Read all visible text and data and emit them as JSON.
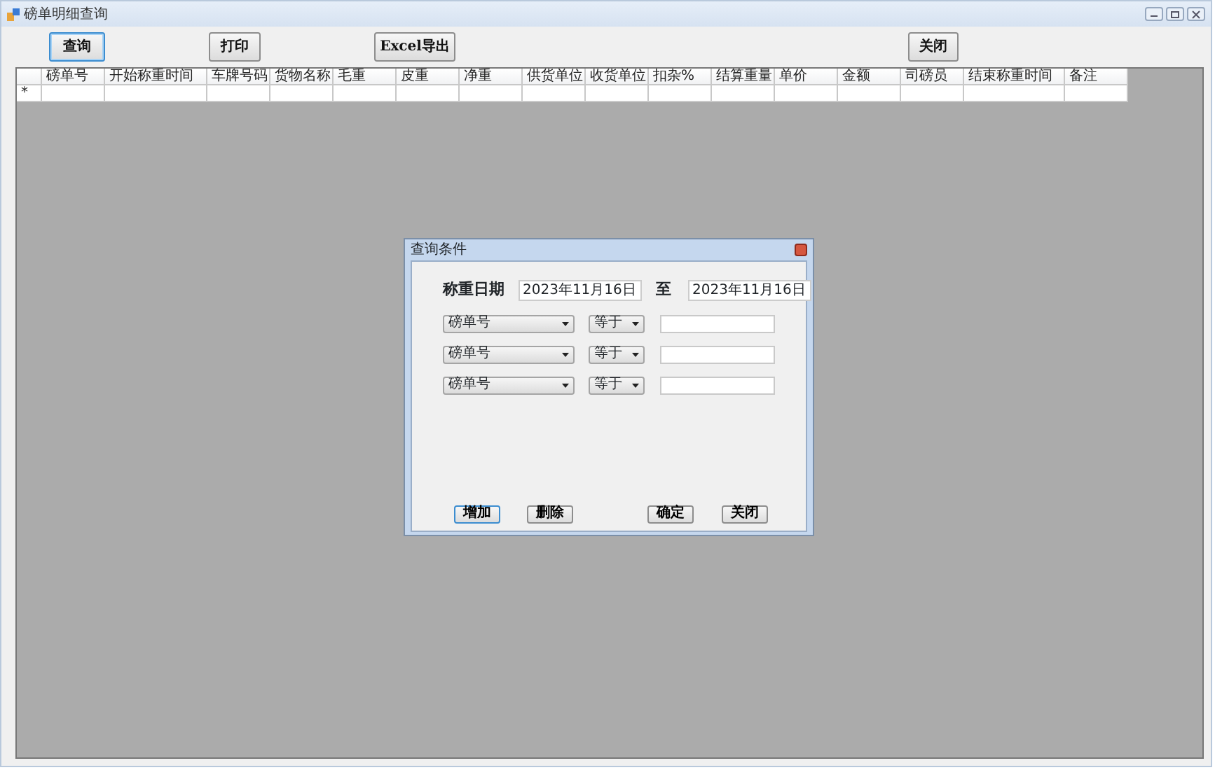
{
  "window": {
    "title": "磅单明细查询"
  },
  "toolbar": [
    {
      "label": "查询",
      "focused": true
    },
    {
      "label": "打印",
      "focused": false
    },
    {
      "label": "Excel导出",
      "focused": false
    },
    {
      "label": "关闭",
      "focused": false
    }
  ],
  "table": {
    "columns": [
      "磅单号",
      "开始称重时间",
      "车牌号码",
      "货物名称",
      "毛重",
      "皮重",
      "净重",
      "供货单位",
      "收货单位",
      "扣杂%",
      "结算重量",
      "单价",
      "金额",
      "司磅员",
      "结束称重时间",
      "备注"
    ],
    "new_row_marker": "*"
  },
  "dialog": {
    "title": "查询条件",
    "date_label": "称重日期",
    "date_from": "2023年11月16日",
    "separator": "至",
    "date_to": "2023年11月16日",
    "conditions": [
      {
        "field": "磅单号",
        "operator": "等于"
      },
      {
        "field": "磅单号",
        "operator": "等于"
      },
      {
        "field": "磅单号",
        "operator": "等于"
      }
    ],
    "buttons": [
      {
        "label": "增加",
        "focused": true
      },
      {
        "label": "删除",
        "focused": false
      },
      {
        "label": "确定",
        "focused": false
      },
      {
        "label": "关闭",
        "focused": false
      }
    ]
  }
}
